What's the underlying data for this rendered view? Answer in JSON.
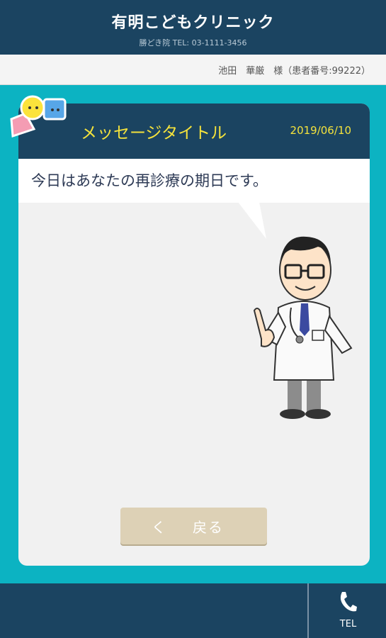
{
  "header": {
    "title": "有明こどもクリニック",
    "subtitle": "勝どき院 TEL: 03-1111-3456"
  },
  "patient": {
    "label": "池田　華厳　様（患者番号:99222）"
  },
  "message": {
    "title": "メッセージタイトル",
    "date": "2019/06/10",
    "body": "今日はあなたの再診療の期日です。"
  },
  "back_button": {
    "chevron": "く",
    "label": "戻る"
  },
  "footer": {
    "tel_label": "TEL",
    "tel_icon": "phone-icon"
  },
  "colors": {
    "navy": "#1b4461",
    "teal": "#0cb3c2",
    "accent_yellow": "#f4e23c",
    "button_beige": "#ddd1b6"
  }
}
